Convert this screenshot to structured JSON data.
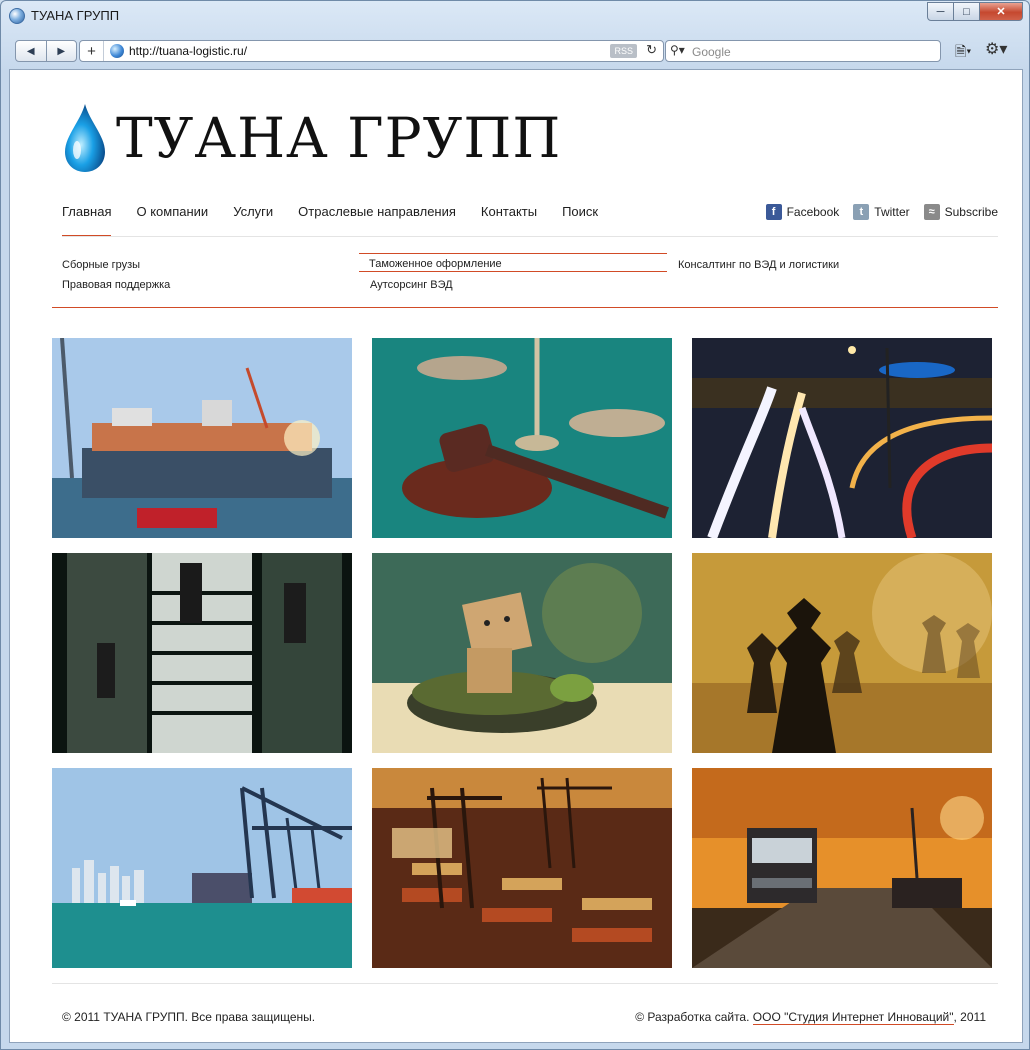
{
  "browser": {
    "window_title": "ТУАНА ГРУПП",
    "url": "http://tuana-logistic.ru/",
    "rss_label": "RSS",
    "search_placeholder": "Google"
  },
  "site": {
    "logo_text": "ТУАНА ГРУПП",
    "nav": [
      {
        "label": "Главная",
        "active": true
      },
      {
        "label": "О компании"
      },
      {
        "label": "Услуги"
      },
      {
        "label": "Отраслевые направления"
      },
      {
        "label": "Контакты"
      },
      {
        "label": "Поиск"
      }
    ],
    "social": [
      {
        "label": "Facebook",
        "icon": "facebook-icon",
        "color": "#3b5998"
      },
      {
        "label": "Twitter",
        "icon": "twitter-icon",
        "color": "#8aa0b4"
      },
      {
        "label": "Subscribe",
        "icon": "rss-icon",
        "color": "#8a8a8a"
      }
    ],
    "subnav": [
      {
        "label": "Сборные грузы"
      },
      {
        "label": "Таможенное оформление",
        "active": true
      },
      {
        "label": "Консалтинг по ВЭД и логистики"
      },
      {
        "label": "Правовая поддержка"
      },
      {
        "label": "Аутсорсинг ВЭД"
      }
    ],
    "gallery": [
      "container-ship-photo",
      "judge-gavel-photo",
      "highway-night-photo",
      "escalators-photo",
      "box-robot-turtle-photo",
      "chess-pieces-photo",
      "port-cranes-photo",
      "container-terminal-photo",
      "truck-pier-photo"
    ],
    "footer_left": "© 2011 ТУАНА ГРУПП. Все права защищены.",
    "footer_right_prefix": "© Разработка сайта. ",
    "footer_link": "ООО \"Студия Интернет Инноваций\"",
    "footer_right_suffix": ", 2011",
    "accent_color": "#d14b26"
  }
}
